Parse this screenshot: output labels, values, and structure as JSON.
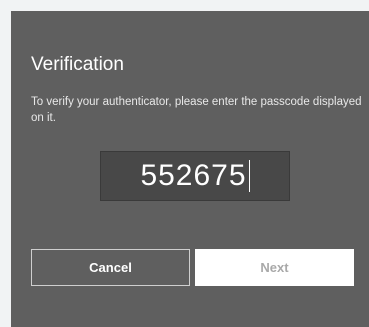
{
  "dialog": {
    "title": "Verification",
    "description": "To verify your authenticator, please enter the passcode displayed on it.",
    "passcode_value": "552675",
    "buttons": {
      "cancel_label": "Cancel",
      "next_label": "Next"
    }
  }
}
